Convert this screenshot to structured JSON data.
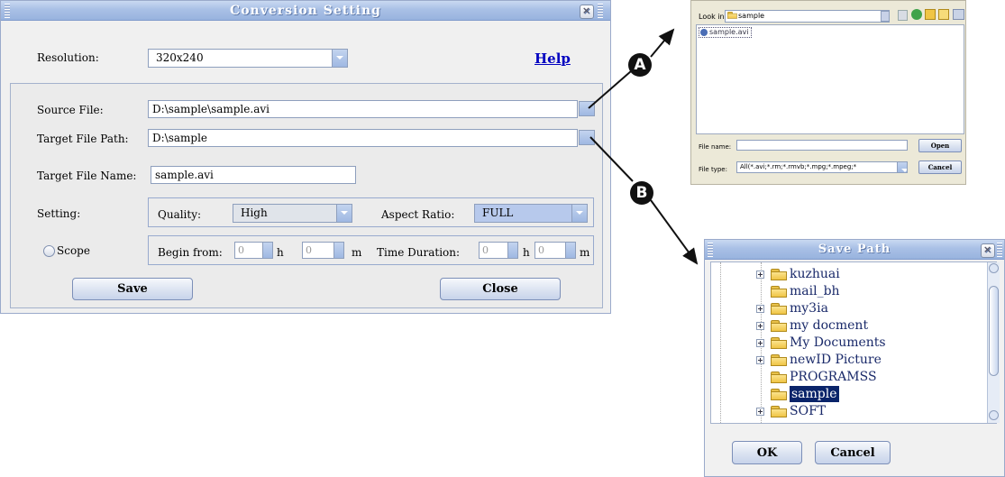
{
  "main_dialog": {
    "title": "Conversion Setting",
    "close_glyph": "×",
    "resolution_label": "Resolution:",
    "resolution_value": "320x240",
    "help_link": "Help",
    "source_file_label": "Source File:",
    "source_file_value": "D:\\sample\\sample.avi",
    "target_path_label": "Target File Path:",
    "target_path_value": "D:\\sample",
    "target_name_label": "Target File Name:",
    "target_name_value": "sample.avi",
    "setting_label": "Setting:",
    "quality_label": "Quality:",
    "quality_value": "High",
    "aspect_label": "Aspect Ratio:",
    "aspect_value": "FULL",
    "scope_label": "Scope",
    "begin_label": "Begin from:",
    "begin_h_value": "0",
    "h_unit": "h",
    "begin_m_value": "0",
    "m_unit": "m",
    "duration_label": "Time Duration:",
    "duration_h_value": "0",
    "duration_m_value": "0",
    "save_button": "Save",
    "close_button": "Close"
  },
  "callouts": {
    "a": "A",
    "b": "B"
  },
  "open_dialog": {
    "look_in_label": "Look in:",
    "look_in_value": "sample",
    "file_item": "sample.avi",
    "file_name_label": "File name:",
    "file_name_value": "",
    "file_type_label": "File type:",
    "file_type_value": "All(*.avi;*.rm;*.rmvb;*.mpg;*.mpeg;*",
    "open_button": "Open",
    "cancel_button": "Cancel"
  },
  "save_path_dialog": {
    "title": "Save Path",
    "close_glyph": "×",
    "folders": [
      {
        "name": "kuzhuai",
        "expandable": true,
        "selected": false
      },
      {
        "name": "mail_bh",
        "expandable": false,
        "selected": false
      },
      {
        "name": "my3ia",
        "expandable": true,
        "selected": false
      },
      {
        "name": "my docment",
        "expandable": true,
        "selected": false
      },
      {
        "name": "My Documents",
        "expandable": true,
        "selected": false
      },
      {
        "name": "newID Picture",
        "expandable": true,
        "selected": false
      },
      {
        "name": "PROGRAMSS",
        "expandable": false,
        "selected": false
      },
      {
        "name": "sample",
        "expandable": false,
        "selected": true
      },
      {
        "name": "SOFT",
        "expandable": true,
        "selected": false
      }
    ],
    "ok_button": "OK",
    "cancel_button": "Cancel"
  },
  "colors": {
    "title_bar": "#a9c0e6",
    "selected_bg": "#0a246a",
    "help_link": "#0000c0"
  }
}
